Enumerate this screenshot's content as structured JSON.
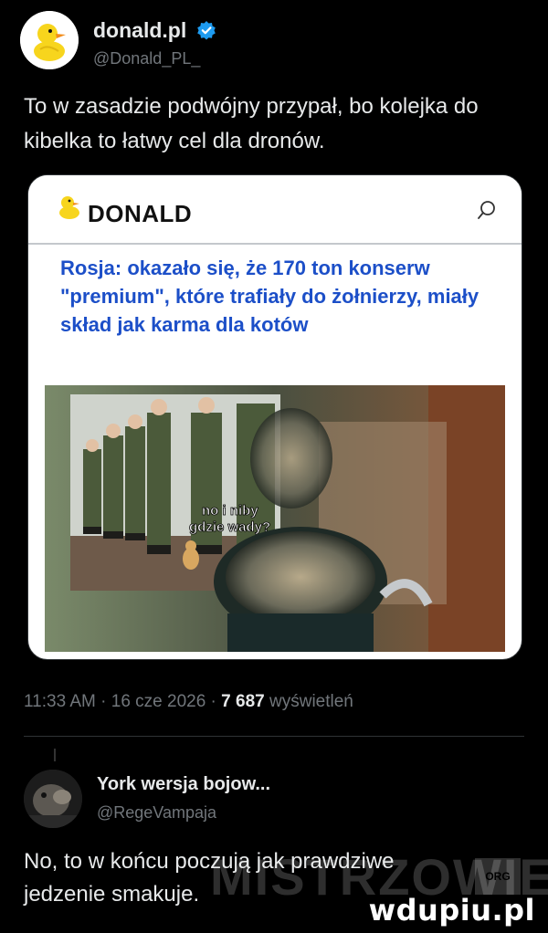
{
  "tweet": {
    "author_name": "donald.pl",
    "author_handle": "@Donald_PL_",
    "text": "To w zasadzie podwójny przypał, bo kolejka do kibelka to łatwy cel dla dronów.",
    "timestamp": "11:33 AM · 16 cze 2026 · ",
    "views_count": "7 687",
    "views_label": " wyświetleń"
  },
  "card": {
    "site_name": "DONALD",
    "article_title": "Rosja: okazało się, że 170 ton konserw \"premium\", które trafiały do żołnierzy, miały skład jak karma dla kotów",
    "meme_caption_1": "no i niby",
    "meme_caption_2": "gdzie wady?"
  },
  "reply": {
    "author_name": "York wersja bojow...",
    "author_handle": "@RegeVampaja",
    "text": "No, to w końcu poczują jak prawdziwe jedzenie smakuje."
  },
  "watermarks": {
    "overlay": "MISTRZOWIE",
    "badge": "ORG",
    "site": "wdupiu.pl"
  },
  "colors": {
    "background": "#000000",
    "text_primary": "#e7e9ea",
    "text_secondary": "#71767b",
    "verified_blue": "#1d9bf0",
    "headline_blue": "#1c4fc8"
  },
  "icons": {
    "avatar": "duck-icon",
    "verified": "verified-badge-icon",
    "site_logo": "duck-icon",
    "search": "search-icon"
  }
}
